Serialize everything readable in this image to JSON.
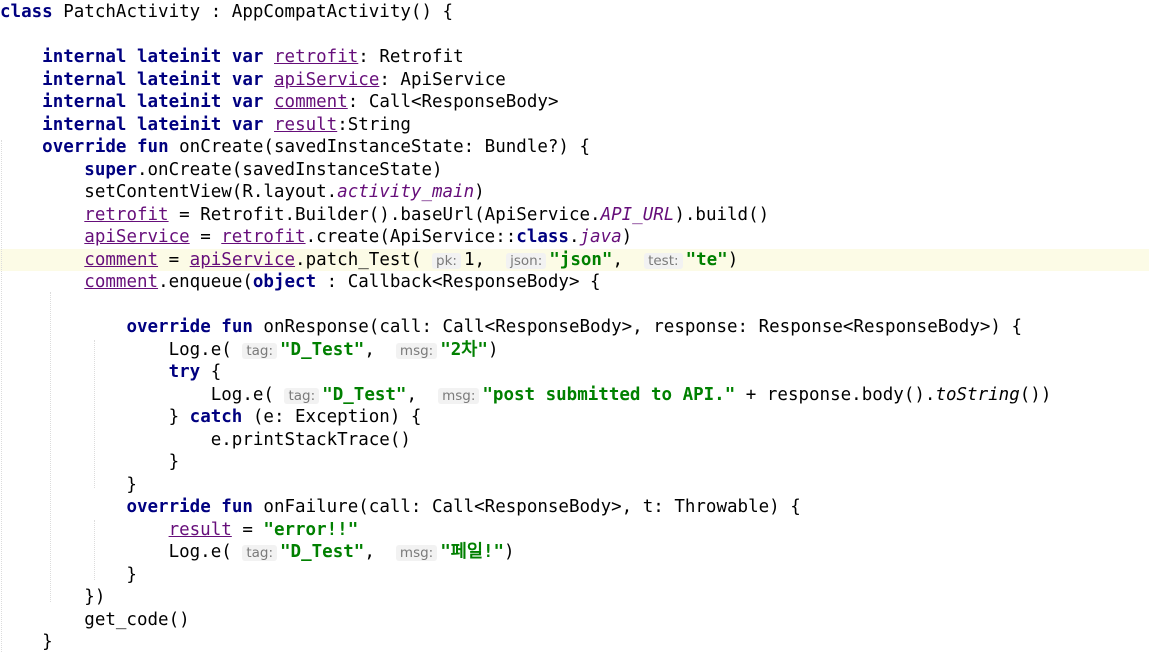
{
  "editor": {
    "lines": [
      {
        "segments": [
          {
            "t": "class",
            "c": "kw"
          },
          {
            "t": " PatchActivity : AppCompatActivity() {"
          }
        ]
      },
      {
        "segments": []
      },
      {
        "segments": [
          {
            "t": "    "
          },
          {
            "t": "internal",
            "c": "kw"
          },
          {
            "t": " "
          },
          {
            "t": "lateinit",
            "c": "kw"
          },
          {
            "t": " "
          },
          {
            "t": "var",
            "c": "kw"
          },
          {
            "t": " "
          },
          {
            "t": "retrofit",
            "c": "prop"
          },
          {
            "t": ": Retrofit"
          }
        ]
      },
      {
        "segments": [
          {
            "t": "    "
          },
          {
            "t": "internal",
            "c": "kw"
          },
          {
            "t": " "
          },
          {
            "t": "lateinit",
            "c": "kw"
          },
          {
            "t": " "
          },
          {
            "t": "var",
            "c": "kw"
          },
          {
            "t": " "
          },
          {
            "t": "apiService",
            "c": "prop"
          },
          {
            "t": ": ApiService"
          }
        ]
      },
      {
        "segments": [
          {
            "t": "    "
          },
          {
            "t": "internal",
            "c": "kw"
          },
          {
            "t": " "
          },
          {
            "t": "lateinit",
            "c": "kw"
          },
          {
            "t": " "
          },
          {
            "t": "var",
            "c": "kw"
          },
          {
            "t": " "
          },
          {
            "t": "comment",
            "c": "prop"
          },
          {
            "t": ": Call<ResponseBody>"
          }
        ]
      },
      {
        "segments": [
          {
            "t": "    "
          },
          {
            "t": "internal",
            "c": "kw"
          },
          {
            "t": " "
          },
          {
            "t": "lateinit",
            "c": "kw"
          },
          {
            "t": " "
          },
          {
            "t": "var",
            "c": "kw"
          },
          {
            "t": " "
          },
          {
            "t": "result",
            "c": "prop"
          },
          {
            "t": ":String"
          }
        ]
      },
      {
        "segments": [
          {
            "t": "    "
          },
          {
            "t": "override",
            "c": "kw"
          },
          {
            "t": " "
          },
          {
            "t": "fun",
            "c": "kw"
          },
          {
            "t": " onCreate(savedInstanceState: Bundle?) {"
          }
        ]
      },
      {
        "segments": [
          {
            "t": "        "
          },
          {
            "t": "super",
            "c": "kw"
          },
          {
            "t": ".onCreate(savedInstanceState)"
          }
        ]
      },
      {
        "segments": [
          {
            "t": "        setContentView(R.layout."
          },
          {
            "t": "activity_main",
            "c": "ital"
          },
          {
            "t": ")"
          }
        ]
      },
      {
        "segments": [
          {
            "t": "        "
          },
          {
            "t": "retrofit",
            "c": "prop"
          },
          {
            "t": " = Retrofit.Builder().baseUrl(ApiService."
          },
          {
            "t": "API_URL",
            "c": "ital"
          },
          {
            "t": ").build()"
          }
        ]
      },
      {
        "segments": [
          {
            "t": "        "
          },
          {
            "t": "apiService",
            "c": "prop"
          },
          {
            "t": " = "
          },
          {
            "t": "retrofit",
            "c": "prop"
          },
          {
            "t": ".create(ApiService::"
          },
          {
            "t": "class",
            "c": "kw"
          },
          {
            "t": "."
          },
          {
            "t": "java",
            "c": "ital"
          },
          {
            "t": ")"
          }
        ]
      },
      {
        "current": true,
        "segments": [
          {
            "t": "        "
          },
          {
            "t": "comment",
            "c": "prop"
          },
          {
            "t": " = "
          },
          {
            "t": "apiService",
            "c": "prop"
          },
          {
            "t": ".patch_Test( "
          },
          {
            "t": "pk:",
            "c": "hint"
          },
          {
            "t": "1,  "
          },
          {
            "t": "json:",
            "c": "hint"
          },
          {
            "t": "\"json\"",
            "c": "str"
          },
          {
            "t": ",  "
          },
          {
            "t": "test:",
            "c": "hint"
          },
          {
            "t": "\"te\"",
            "c": "str"
          },
          {
            "t": ")"
          }
        ]
      },
      {
        "segments": [
          {
            "t": "        "
          },
          {
            "t": "comment",
            "c": "prop"
          },
          {
            "t": ".enqueue("
          },
          {
            "t": "object",
            "c": "kw"
          },
          {
            "t": " : Callback<ResponseBody> {"
          }
        ]
      },
      {
        "segments": []
      },
      {
        "segments": [
          {
            "t": "            "
          },
          {
            "t": "override",
            "c": "kw"
          },
          {
            "t": " "
          },
          {
            "t": "fun",
            "c": "kw"
          },
          {
            "t": " onResponse(call: Call<ResponseBody>, response: Response<ResponseBody>) {"
          }
        ]
      },
      {
        "segments": [
          {
            "t": "                Log.e( "
          },
          {
            "t": "tag:",
            "c": "hint"
          },
          {
            "t": "\"D_Test\"",
            "c": "str"
          },
          {
            "t": ",  "
          },
          {
            "t": "msg:",
            "c": "hint"
          },
          {
            "t": "\"2차\"",
            "c": "str"
          },
          {
            "t": ")"
          }
        ]
      },
      {
        "segments": [
          {
            "t": "                "
          },
          {
            "t": "try",
            "c": "kw"
          },
          {
            "t": " {"
          }
        ]
      },
      {
        "segments": [
          {
            "t": "                    Log.e( "
          },
          {
            "t": "tag:",
            "c": "hint"
          },
          {
            "t": "\"D_Test\"",
            "c": "str"
          },
          {
            "t": ",  "
          },
          {
            "t": "msg:",
            "c": "hint"
          },
          {
            "t": "\"post submitted to API.\"",
            "c": "str"
          },
          {
            "t": " + response.body()."
          },
          {
            "t": "toString",
            "c": "fn-ital"
          },
          {
            "t": "())"
          }
        ]
      },
      {
        "segments": [
          {
            "t": "                } "
          },
          {
            "t": "catch",
            "c": "kw"
          },
          {
            "t": " (e: Exception) {"
          }
        ]
      },
      {
        "segments": [
          {
            "t": "                    e.printStackTrace()"
          }
        ]
      },
      {
        "segments": [
          {
            "t": "                }"
          }
        ]
      },
      {
        "segments": [
          {
            "t": "            }"
          }
        ]
      },
      {
        "segments": [
          {
            "t": "            "
          },
          {
            "t": "override",
            "c": "kw"
          },
          {
            "t": " "
          },
          {
            "t": "fun",
            "c": "kw"
          },
          {
            "t": " onFailure(call: Call<ResponseBody>, t: Throwable) {"
          }
        ]
      },
      {
        "segments": [
          {
            "t": "                "
          },
          {
            "t": "result",
            "c": "prop"
          },
          {
            "t": " = "
          },
          {
            "t": "\"error!!\"",
            "c": "str"
          }
        ]
      },
      {
        "segments": [
          {
            "t": "                Log.e( "
          },
          {
            "t": "tag:",
            "c": "hint"
          },
          {
            "t": "\"D_Test\"",
            "c": "str"
          },
          {
            "t": ",  "
          },
          {
            "t": "msg:",
            "c": "hint"
          },
          {
            "t": "\"페일!\"",
            "c": "str"
          },
          {
            "t": ")"
          }
        ]
      },
      {
        "segments": [
          {
            "t": "            }"
          }
        ]
      },
      {
        "segments": [
          {
            "t": "        })"
          }
        ]
      },
      {
        "segments": [
          {
            "t": "        get_code()"
          }
        ]
      },
      {
        "segments": [
          {
            "t": "    }"
          }
        ]
      }
    ]
  },
  "colors": {
    "keyword": "#000080",
    "string": "#008000",
    "property": "#660e7a",
    "current_line": "#fcfbe6",
    "hint_text": "#7a7a7a",
    "hint_bg": "#f2f2f2"
  }
}
